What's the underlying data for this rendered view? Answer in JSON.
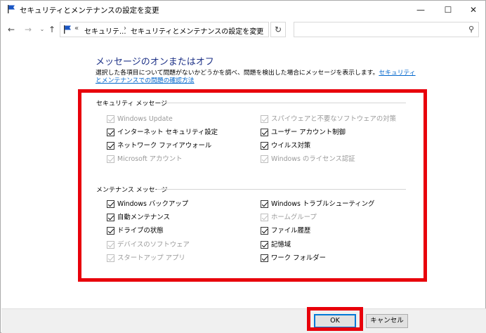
{
  "window": {
    "title": "セキュリティとメンテナンスの設定を変更",
    "minimize": "—",
    "maximize": "☐",
    "close": "✕"
  },
  "nav": {
    "back": "←",
    "forward": "→",
    "recent": "⌄",
    "up": "↑",
    "address_chevron": "«",
    "breadcrumb_1": "セキュリテ...",
    "breadcrumb_sep": "›",
    "breadcrumb_2": "セキュリティとメンテナンスの設定を変更",
    "address_dropdown": "⌄",
    "refresh": "↻",
    "search_placeholder": ""
  },
  "main": {
    "heading": "メッセージのオンまたはオフ",
    "description_text": "選択した各項目について問題がないかどうかを調べ、問題を検出した場合にメッセージを表示します。",
    "description_link": "セキュリティとメンテナンスでの問題の確認方法"
  },
  "security": {
    "label": "セキュリティ メッセージ",
    "left": [
      {
        "label": "Windows Update",
        "checked": true,
        "disabled": true
      },
      {
        "label": "インターネット セキュリティ設定",
        "checked": true,
        "disabled": false
      },
      {
        "label": "ネットワーク ファイアウォール",
        "checked": true,
        "disabled": false
      },
      {
        "label": "Microsoft アカウント",
        "checked": true,
        "disabled": true
      }
    ],
    "right": [
      {
        "label": "スパイウェアと不要なソフトウェアの対策",
        "checked": true,
        "disabled": true
      },
      {
        "label": "ユーザー アカウント制御",
        "checked": true,
        "disabled": false
      },
      {
        "label": "ウイルス対策",
        "checked": true,
        "disabled": false
      },
      {
        "label": "Windows のライセンス認証",
        "checked": true,
        "disabled": true
      }
    ]
  },
  "maintenance": {
    "label": "メンテナンス メッセージ",
    "left": [
      {
        "label": "Windows バックアップ",
        "checked": true,
        "disabled": false
      },
      {
        "label": "自動メンテナンス",
        "checked": true,
        "disabled": false
      },
      {
        "label": "ドライブの状態",
        "checked": true,
        "disabled": false
      },
      {
        "label": "デバイスのソフトウェア",
        "checked": true,
        "disabled": true
      },
      {
        "label": "スタートアップ アプリ",
        "checked": true,
        "disabled": true
      }
    ],
    "right": [
      {
        "label": "Windows トラブルシューティング",
        "checked": true,
        "disabled": false
      },
      {
        "label": "ホームグループ",
        "checked": true,
        "disabled": true
      },
      {
        "label": "ファイル履歴",
        "checked": true,
        "disabled": false
      },
      {
        "label": "記憶域",
        "checked": true,
        "disabled": false
      },
      {
        "label": "ワーク フォルダー",
        "checked": true,
        "disabled": false
      }
    ]
  },
  "footer": {
    "ok": "OK",
    "cancel": "キャンセル"
  },
  "colors": {
    "highlight": "#e8000b",
    "heading": "#1e3287",
    "link": "#0066cc",
    "ok_border": "#0078d7"
  }
}
